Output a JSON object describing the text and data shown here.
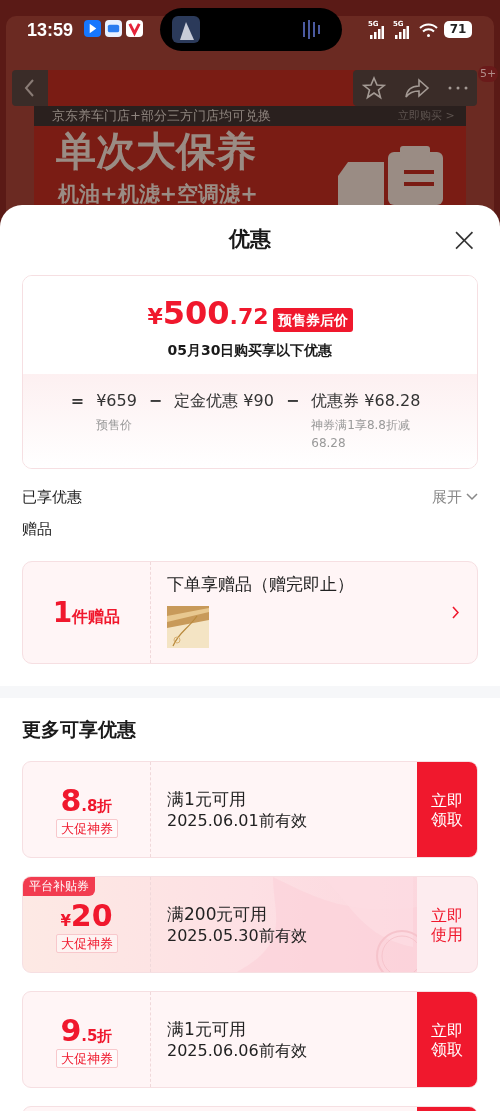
{
  "status_bar": {
    "time": "13:59",
    "network_1": "5G",
    "network_2": "5G",
    "battery": "71"
  },
  "background_page": {
    "badge": "5+",
    "banner_caption": "京东养车门店+部分三方门店均可兑换",
    "banner_link": "立即购买 >",
    "banner_title": "单次大保养",
    "banner_subtitle": "机油+机滤+空调滤+"
  },
  "sheet": {
    "title": "优惠",
    "close": "×"
  },
  "price_card": {
    "currency": "¥",
    "price_int": "500",
    "price_dec": ".72",
    "price_tag": "预售券后价",
    "date_note": "05月30日购买享以下优惠",
    "terms": [
      {
        "operator": "=",
        "amount": "¥659",
        "note": "预售价"
      },
      {
        "operator": "−",
        "label": "定金优惠",
        "amount": "¥90"
      },
      {
        "operator": "−",
        "label": "优惠券",
        "amount": "¥68.28",
        "note": "神券满1享8.8折减68.28"
      }
    ]
  },
  "enjoyed": {
    "title": "已享优惠",
    "toggle": "展开",
    "expanded": false
  },
  "gift": {
    "section": "赠品",
    "count": "1",
    "unit": "件赠品",
    "title": "下单享赠品（赠完即止）"
  },
  "more": {
    "title": "更多可享优惠",
    "coupons": [
      {
        "kind": "discount",
        "big": "8",
        "small": ".8折",
        "tag": "大促神券",
        "condition": "满1元可用",
        "validity": "2025.06.01前有效",
        "action": "立即领取",
        "claimed": false
      },
      {
        "kind": "amount",
        "big": "20",
        "small": "¥",
        "tag": "大促神券",
        "ribbon": "平台补贴券",
        "condition": "满200元可用",
        "validity": "2025.05.30前有效",
        "action": "立即使用",
        "claimed": true
      },
      {
        "kind": "discount",
        "big": "9",
        "small": ".5折",
        "tag": "大促神券",
        "condition": "满1元可用",
        "validity": "2025.06.06前有效",
        "action": "立即领取",
        "claimed": false
      },
      {
        "kind": "partial"
      }
    ]
  }
}
